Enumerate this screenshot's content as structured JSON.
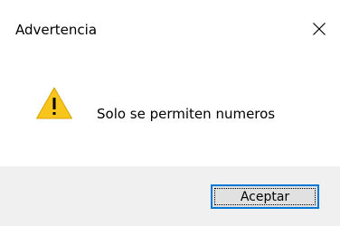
{
  "dialog": {
    "title": "Advertencia",
    "message": "Solo se permiten numeros",
    "ok_label": "Aceptar",
    "icon": "warning-icon",
    "close_icon": "close-icon"
  },
  "colors": {
    "footer_bg": "#f0f0f0",
    "button_bg": "#e1e1e1",
    "button_focus_border": "#0078d7",
    "warning_fill": "#f8c51c"
  }
}
